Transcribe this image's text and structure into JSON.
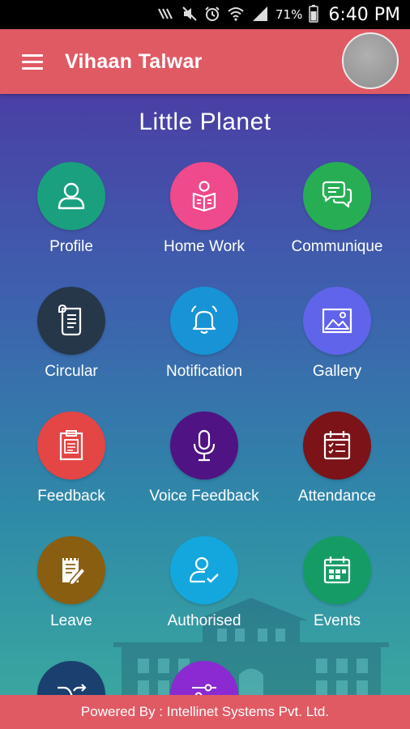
{
  "status_bar": {
    "battery_percent": "71%",
    "time": "6:40 PM",
    "icons": [
      "nfc-icon",
      "mute-icon",
      "alarm-icon",
      "wifi-icon",
      "signal-icon",
      "battery-icon"
    ]
  },
  "app_bar": {
    "user_name": "Vihaan Talwar",
    "menu_icon": "hamburger-icon"
  },
  "school": {
    "name": "Little Planet"
  },
  "modules": [
    {
      "label": "Profile",
      "icon": "person-icon",
      "color": "#1aa07e"
    },
    {
      "label": "Home Work",
      "icon": "reading-icon",
      "color": "#ee4a8c"
    },
    {
      "label": "Communique",
      "icon": "chat-bubbles-icon",
      "color": "#27ae54"
    },
    {
      "label": "Circular",
      "icon": "scroll-icon",
      "color": "#26374a"
    },
    {
      "label": "Notification",
      "icon": "bell-icon",
      "color": "#1793d6"
    },
    {
      "label": "Gallery",
      "icon": "image-icon",
      "color": "#6064ea"
    },
    {
      "label": "Feedback",
      "icon": "clipboard-icon",
      "color": "#e44545"
    },
    {
      "label": "Voice Feedback",
      "icon": "microphone-icon",
      "color": "#4f1383"
    },
    {
      "label": "Attendance",
      "icon": "calendar-check-icon",
      "color": "#7b1318"
    },
    {
      "label": "Leave",
      "icon": "note-pencil-icon",
      "color": "#8a5e10"
    },
    {
      "label": "Authorised",
      "icon": "user-check-icon",
      "color": "#14a7de"
    },
    {
      "label": "Events",
      "icon": "calendar-icon",
      "color": "#159c64"
    },
    {
      "label": "",
      "icon": "shuffle-icon",
      "color": "#19406e"
    },
    {
      "label": "",
      "icon": "sliders-icon",
      "color": "#8b2ad1"
    }
  ],
  "footer": {
    "text": "Powered By : Intellinet Systems Pvt. Ltd."
  }
}
